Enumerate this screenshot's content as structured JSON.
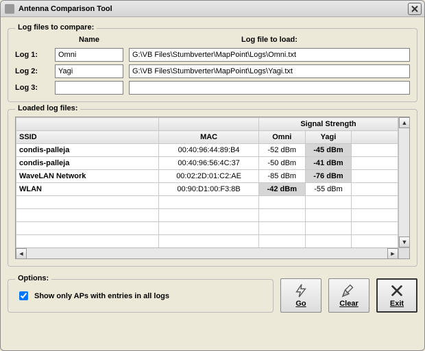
{
  "window": {
    "title": "Antenna Comparison Tool"
  },
  "group1": {
    "legend": "Log files to compare:",
    "headers": {
      "name": "Name",
      "file": "Log file to load:"
    },
    "rows": [
      {
        "label": "Log 1:",
        "name": "Omni",
        "file": "G:\\VB Files\\Stumbverter\\MapPoint\\Logs\\Omni.txt"
      },
      {
        "label": "Log 2:",
        "name": "Yagi",
        "file": "G:\\VB Files\\Stumbverter\\MapPoint\\Logs\\Yagi.txt"
      },
      {
        "label": "Log 3:",
        "name": "",
        "file": ""
      }
    ]
  },
  "group2": {
    "legend": "Loaded log files:",
    "headers": {
      "group_signal": "Signal Strength",
      "ssid": "SSID",
      "mac": "MAC",
      "omni": "Omni",
      "yagi": "Yagi"
    },
    "rows": [
      {
        "ssid": "condis-palleja",
        "mac": "00:40:96:44:89:B4",
        "omni": "-52 dBm",
        "yagi": "-45 dBm",
        "hl": "yagi"
      },
      {
        "ssid": "condis-palleja",
        "mac": "00:40:96:56:4C:37",
        "omni": "-50 dBm",
        "yagi": "-41 dBm",
        "hl": "yagi"
      },
      {
        "ssid": "WaveLAN Network",
        "mac": "00:02:2D:01:C2:AE",
        "omni": "-85 dBm",
        "yagi": "-76 dBm",
        "hl": "yagi"
      },
      {
        "ssid": "WLAN",
        "mac": "00:90:D1:00:F3:8B",
        "omni": "-42 dBm",
        "yagi": "-55 dBm",
        "hl": "omni"
      }
    ]
  },
  "options": {
    "legend": "Options:",
    "show_only_label": "Show only APs with entries in all logs",
    "show_only_checked": true
  },
  "buttons": {
    "go": "Go",
    "clear": "Clear",
    "exit": "Exit"
  }
}
